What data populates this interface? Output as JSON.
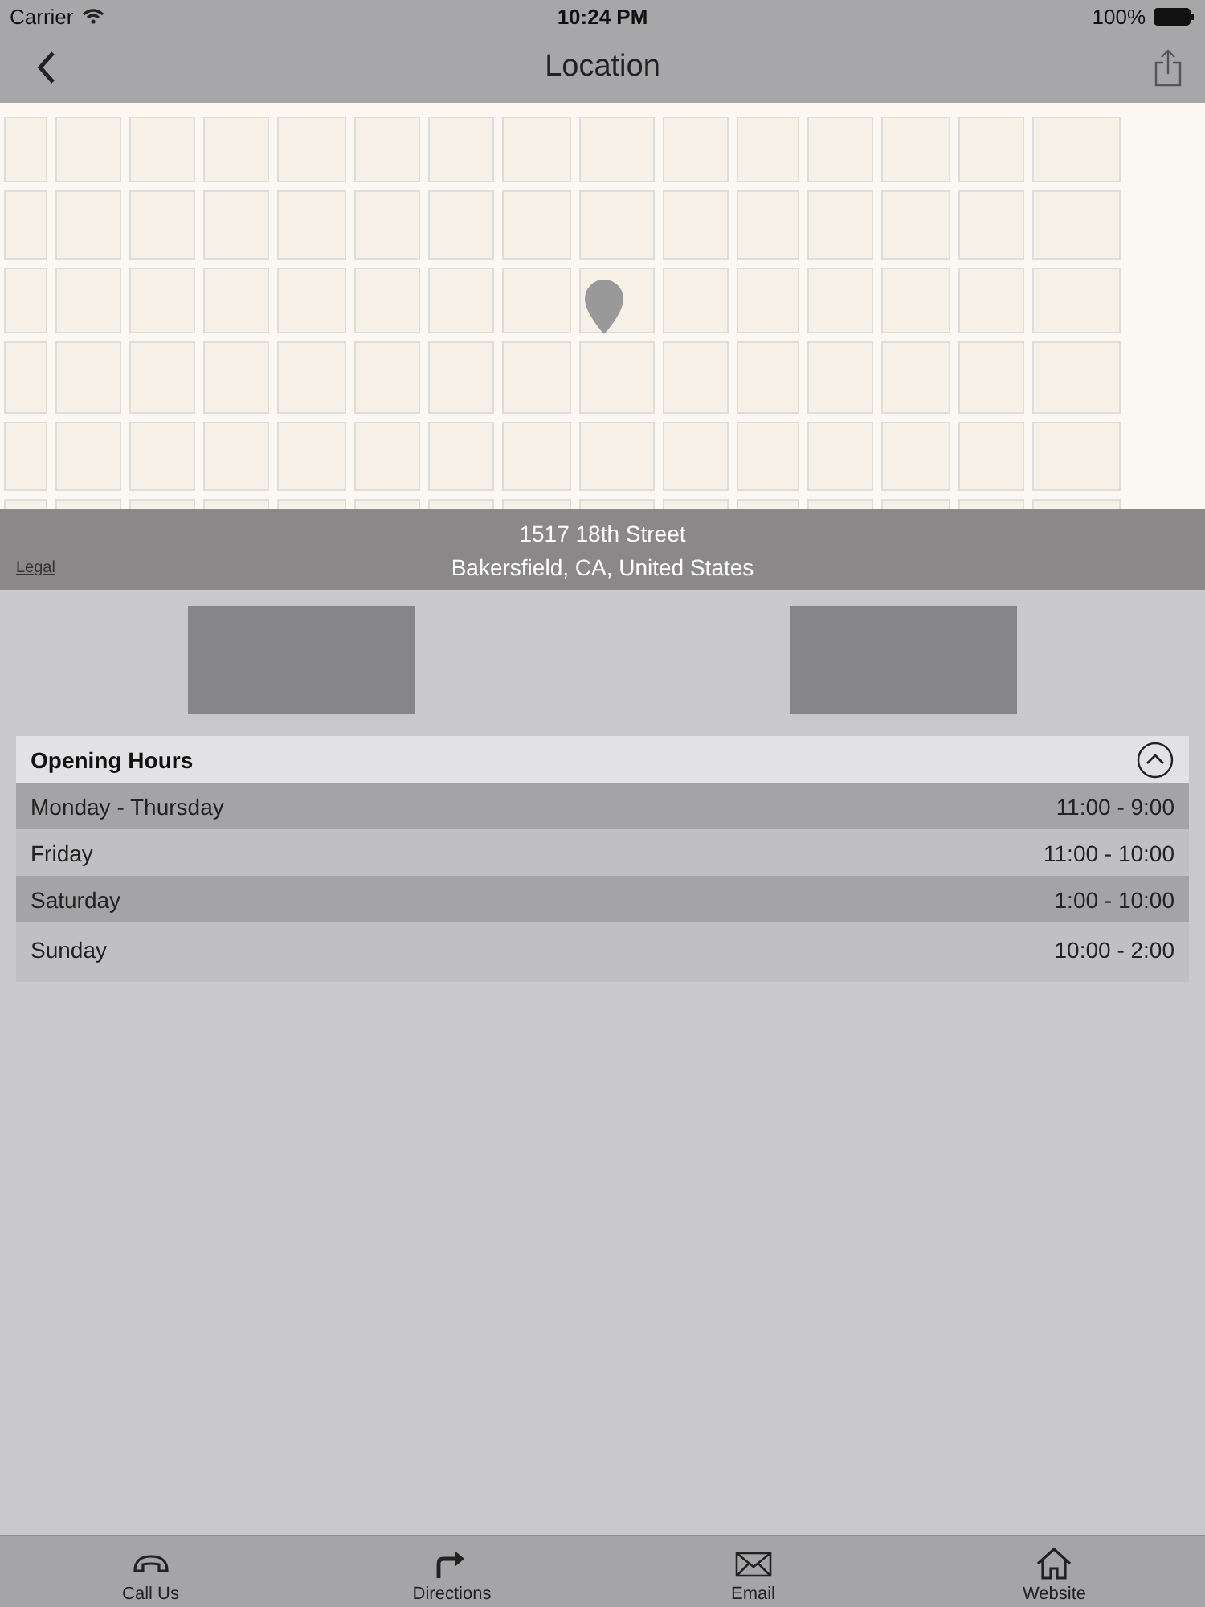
{
  "status_bar": {
    "carrier": "Carrier",
    "time": "10:24 PM",
    "battery": "100%"
  },
  "nav_bar": {
    "title": "Location"
  },
  "map": {
    "legal": "Legal",
    "address_lines": [
      "1517 18th Street",
      "Bakersfield, CA, United States"
    ]
  },
  "opening_hours": {
    "title": "Opening Hours",
    "expanded": true,
    "rows": [
      {
        "day": "Monday - Thursday",
        "hours": "11:00 - 9:00"
      },
      {
        "day": "Friday",
        "hours": "11:00 - 10:00"
      },
      {
        "day": "Saturday",
        "hours": "1:00 - 10:00"
      },
      {
        "day": "Sunday",
        "hours": "10:00 - 2:00"
      }
    ]
  },
  "tab_bar": [
    {
      "kind": "phone",
      "label": "Call Us"
    },
    {
      "kind": "directions",
      "label": "Directions"
    },
    {
      "kind": "email",
      "label": "Email"
    },
    {
      "kind": "home",
      "label": "Website"
    }
  ]
}
